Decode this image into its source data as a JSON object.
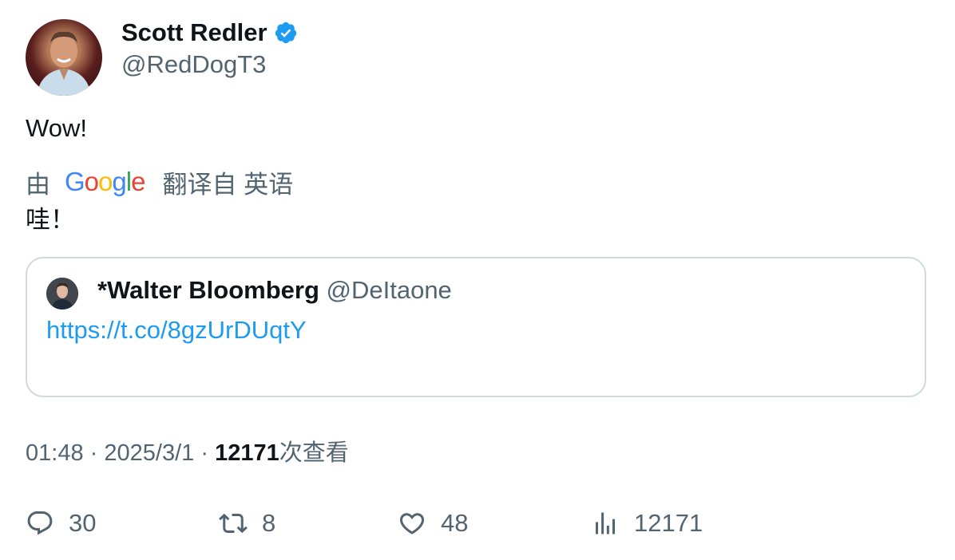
{
  "author": {
    "name": "Scott Redler",
    "handle": "@RedDogT3",
    "verified": true,
    "verified_color": "#1d9bf0"
  },
  "tweet": {
    "text": "Wow!",
    "translation": {
      "prefix": "由",
      "provider_logo": "Google",
      "suffix": "翻译自 英语",
      "text": "哇！"
    }
  },
  "quote": {
    "name": "*Walter Bloomberg",
    "handle": "@DeItaone",
    "link": "https://t.co/8gzUrDUqtY"
  },
  "meta": {
    "time": "01:48",
    "sep1": "·",
    "date": "2025/3/1",
    "sep2": "·",
    "views": "12171",
    "views_label": "次查看"
  },
  "actions": {
    "replies": "30",
    "retweets": "8",
    "likes": "48",
    "views": "12171"
  },
  "colors": {
    "text_primary": "#0f1419",
    "text_secondary": "#536471",
    "link": "#1d9bf0",
    "border": "#cfd9de"
  }
}
